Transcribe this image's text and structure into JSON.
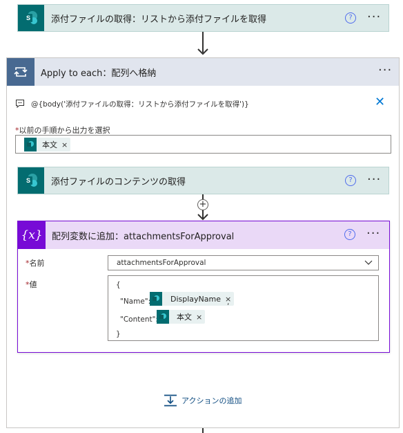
{
  "step1": {
    "title": "添付ファイルの取得：リストから添付ファイルを取得",
    "help": "?",
    "more": "···"
  },
  "loop": {
    "title": "Apply to each：配列へ格納",
    "more": "···",
    "expression": "@{body('添付ファイルの取得：リストから添付ファイルを取得')}",
    "close": "✕",
    "select_label": "以前の手順から出力を選択",
    "required_mark": "*",
    "token_label": "本文",
    "token_remove": "×"
  },
  "step2": {
    "title": "添付ファイルのコンテンツの取得",
    "help": "?",
    "more": "···"
  },
  "insert": "+",
  "step3": {
    "title": "配列変数に追加：attachmentsForApproval",
    "icon_text": "{x}",
    "help": "?",
    "more": "···",
    "name_label": "名前",
    "name_value": "attachmentsForApproval",
    "value_label": "値",
    "json_open": "{",
    "name_key": "\"Name\":",
    "name_token": "DisplayName",
    "comma": ",",
    "content_key": "\"Content\":",
    "content_token": "本文",
    "json_close": "}",
    "token_remove": "×"
  },
  "add_action": "アクションの追加"
}
